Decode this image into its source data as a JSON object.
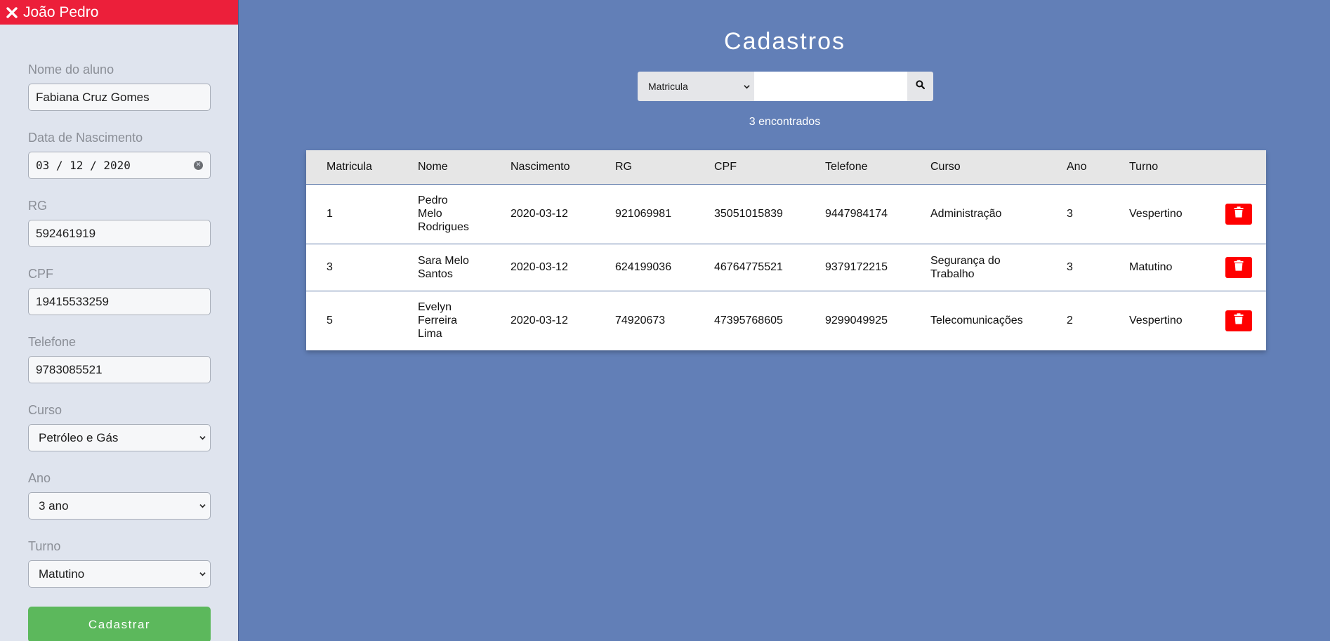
{
  "sidebar": {
    "user_name": "João Pedro",
    "fields": {
      "nome_label": "Nome do aluno",
      "nome_value": "Fabiana Cruz Gomes",
      "data_label": "Data de Nascimento",
      "data_value": "03 / 12 / 2020",
      "rg_label": "RG",
      "rg_value": "592461919",
      "cpf_label": "CPF",
      "cpf_value": "19415533259",
      "telefone_label": "Telefone",
      "telefone_value": "9783085521",
      "curso_label": "Curso",
      "curso_value": "Petróleo e Gás",
      "ano_label": "Ano",
      "ano_value": "3 ano",
      "turno_label": "Turno",
      "turno_value": "Matutino"
    },
    "submit_label": "Cadastrar"
  },
  "main": {
    "title": "Cadastros",
    "search_select": "Matricula",
    "search_value": "",
    "found_text": "3 encontrados",
    "columns": [
      "Matricula",
      "Nome",
      "Nascimento",
      "RG",
      "CPF",
      "Telefone",
      "Curso",
      "Ano",
      "Turno"
    ],
    "rows": [
      {
        "matricula": "1",
        "nome": [
          "Pedro",
          "Melo",
          "Rodrigues"
        ],
        "nascimento": "2020-03-12",
        "rg": "921069981",
        "cpf": "35051015839",
        "telefone": "9447984174",
        "curso": [
          "Administração"
        ],
        "ano": "3",
        "turno": "Vespertino"
      },
      {
        "matricula": "3",
        "nome": [
          "Sara Melo",
          "Santos"
        ],
        "nascimento": "2020-03-12",
        "rg": "624199036",
        "cpf": "46764775521",
        "telefone": "9379172215",
        "curso": [
          "Segurança do",
          "Trabalho"
        ],
        "ano": "3",
        "turno": "Matutino"
      },
      {
        "matricula": "5",
        "nome": [
          "Evelyn",
          "Ferreira",
          "Lima"
        ],
        "nascimento": "2020-03-12",
        "rg": "74920673",
        "cpf": "47395768605",
        "telefone": "9299049925",
        "curso": [
          "Telecomunicações"
        ],
        "ano": "2",
        "turno": "Vespertino"
      }
    ]
  },
  "colors": {
    "background": "#627fb7",
    "sidebar": "#dfe4ee",
    "user_bar": "#ec1f3a",
    "submit": "#5cb85c",
    "delete": "#ff0000"
  }
}
